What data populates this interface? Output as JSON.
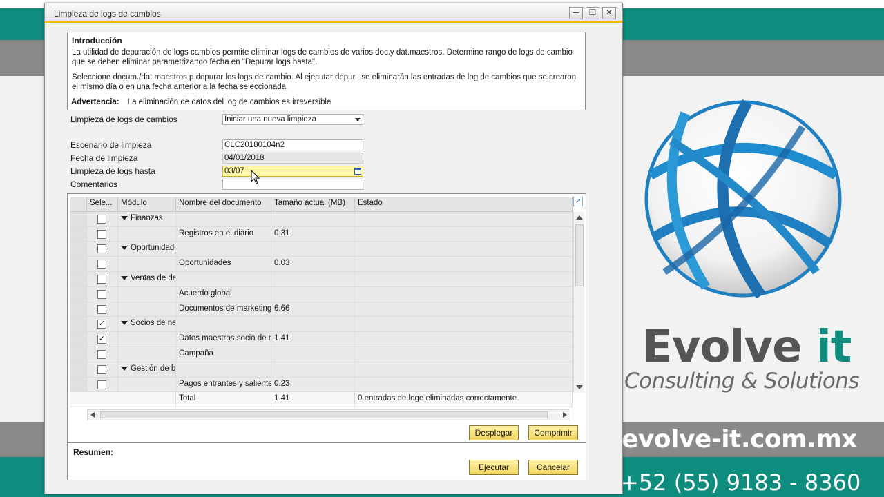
{
  "window": {
    "title": "Limpieza de logs de cambios",
    "minimize": "─",
    "maximize": "☐",
    "close": "✕"
  },
  "intro": {
    "heading": "Introducción",
    "paragraph1": "La utilidad de depuración de logs cambios permite eliminar logs de cambios de varios doc.y dat.maestros. Determine rango de logs de cambio que se deben eliminar parametrizando fecha en \"Depurar logs hasta\".",
    "paragraph2": "Seleccione docum./dat.maestros p.depurar los logs de cambio. Al ejecutar depur., se eliminarán las entradas de log de cambios que se crearon el mismo día o en una fecha anterior a la fecha seleccionada.",
    "warning_label": "Advertencia:",
    "warning_text": "La eliminación de datos del log de cambios es irreversible"
  },
  "form": {
    "cleanup_label": "Limpieza de logs de cambios",
    "cleanup_value": "Iniciar una nueva limpieza",
    "scenario_label": "Escenario de limpieza",
    "scenario_value": "CLC20180104n2",
    "date_label": "Fecha de limpieza",
    "date_value": "04/01/2018",
    "until_label": "Limpieza de logs hasta",
    "until_value": "03/07",
    "comments_label": "Comentarios",
    "comments_value": ""
  },
  "grid": {
    "headers": [
      "Sele...",
      "Módulo",
      "Nombre del documento",
      "Tamaño actual (MB)",
      "Estado"
    ],
    "rows": [
      {
        "checked": "",
        "module": "Finanzas",
        "document": "",
        "size": "",
        "group": true
      },
      {
        "checked": "",
        "module": "",
        "document": "Registros en el diario",
        "size": "0.31",
        "group": false
      },
      {
        "checked": "",
        "module": "Oportunidades",
        "document": "",
        "size": "",
        "group": true
      },
      {
        "checked": "",
        "module": "",
        "document": "Oportunidades",
        "size": "0.03",
        "group": false
      },
      {
        "checked": "",
        "module": "Ventas de deudores",
        "document": "",
        "size": "",
        "group": true
      },
      {
        "checked": "",
        "module": "",
        "document": "Acuerdo global",
        "size": "",
        "group": false
      },
      {
        "checked": "",
        "module": "",
        "document": "Documentos de marketing",
        "size": "6.66",
        "group": false
      },
      {
        "checked": "✓",
        "module": "Socios de negocios",
        "document": "",
        "size": "",
        "group": true
      },
      {
        "checked": "✓",
        "module": "",
        "document": "Datos maestros socio de negocios",
        "size": "1.41",
        "group": false
      },
      {
        "checked": "",
        "module": "",
        "document": "Campaña",
        "size": "",
        "group": false
      },
      {
        "checked": "",
        "module": "Gestión de bancos",
        "document": "",
        "size": "",
        "group": true
      },
      {
        "checked": "",
        "module": "",
        "document": "Pagos entrantes y salientes",
        "size": "0.23",
        "group": false
      }
    ],
    "total_label": "Total",
    "total_size": "1.41",
    "total_status": "0 entradas de loge eliminadas correctamente"
  },
  "buttons": {
    "expand": "Desplegar",
    "collapse": "Comprimir",
    "execute": "Ejecutar",
    "cancel": "Cancelar"
  },
  "summary": {
    "label": "Resumen:"
  },
  "brand": {
    "name_main": "Evolve ",
    "name_accent": "it",
    "tagline": "Consulting & Solutions",
    "url": "evolve-it.com.mx",
    "phone": "+52 (55) 9183 - 8360",
    "color_teal": "#0e8c7e",
    "color_gray": "#8a8a8a"
  }
}
